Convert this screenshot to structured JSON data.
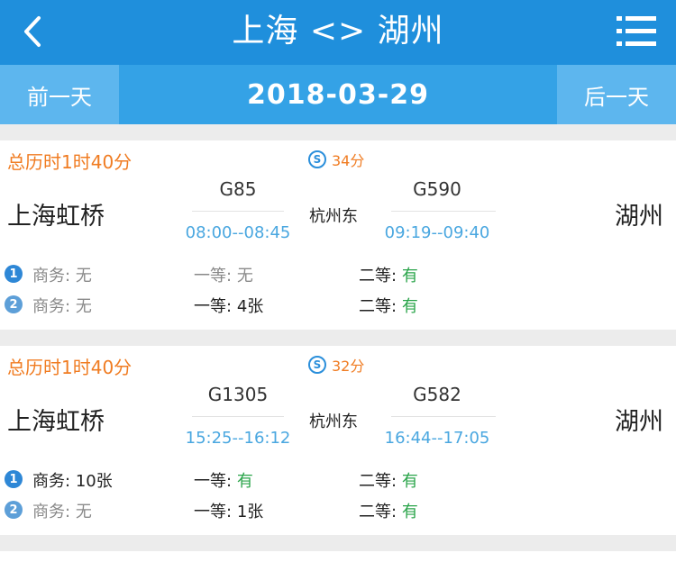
{
  "header": {
    "title": "上海 <> 湖州",
    "back_icon": "chevron-left-icon",
    "menu_icon": "list-menu-icon",
    "bg": "#1f8fdc"
  },
  "datebar": {
    "prev_label": "前一天",
    "date": "2018-03-29",
    "next_label": "后一天"
  },
  "colors": {
    "orange": "#f07c22",
    "blue_time": "#4aa7e0",
    "green": "#2aa44a"
  },
  "cards": [
    {
      "total": "总历时1时40分",
      "transfer_wait": "34分",
      "from": "上海虹桥",
      "transfer_station": "杭州东",
      "to": "湖州",
      "leg1": {
        "train": "G85",
        "time": "08:00--08:45"
      },
      "leg2": {
        "train": "G590",
        "time": "09:19--09:40"
      },
      "seats": [
        {
          "badge": "1",
          "biz_label": "商务:",
          "biz": "无",
          "first_label": "一等:",
          "first": "无",
          "second_label": "二等:",
          "second": "有"
        },
        {
          "badge": "2",
          "biz_label": "商务:",
          "biz": "无",
          "first_label": "一等:",
          "first": "4张",
          "second_label": "二等:",
          "second": "有"
        }
      ]
    },
    {
      "total": "总历时1时40分",
      "transfer_wait": "32分",
      "from": "上海虹桥",
      "transfer_station": "杭州东",
      "to": "湖州",
      "leg1": {
        "train": "G1305",
        "time": "15:25--16:12"
      },
      "leg2": {
        "train": "G582",
        "time": "16:44--17:05"
      },
      "seats": [
        {
          "badge": "1",
          "biz_label": "商务:",
          "biz": "10张",
          "first_label": "一等:",
          "first": "有",
          "second_label": "二等:",
          "second": "有"
        },
        {
          "badge": "2",
          "biz_label": "商务:",
          "biz": "无",
          "first_label": "一等:",
          "first": "1张",
          "second_label": "二等:",
          "second": "有"
        }
      ]
    }
  ]
}
